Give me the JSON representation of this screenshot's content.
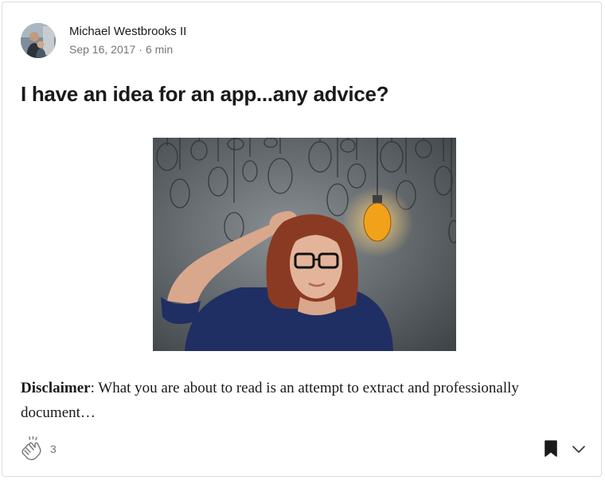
{
  "post": {
    "author": {
      "name": "Michael Westbrooks II",
      "avatar_icon": "author-avatar"
    },
    "meta": {
      "date": "Sep 16, 2017",
      "separator": "·",
      "read_time": "6 min"
    },
    "title": "I have an idea for an app...any advice?",
    "image": {
      "subject": "woman-thinking-under-lightbulbs",
      "lit_bulb_color": "#f2a21a",
      "background_color": "#5c6266"
    },
    "excerpt": {
      "label": "Disclaimer",
      "text": ": What you are about to read is an attempt to extract and professionally document…"
    },
    "footer": {
      "clap_icon": "clap-icon",
      "clap_count": "3",
      "bookmark_icon": "bookmark-icon",
      "more_icon": "chevron-down-icon"
    }
  }
}
